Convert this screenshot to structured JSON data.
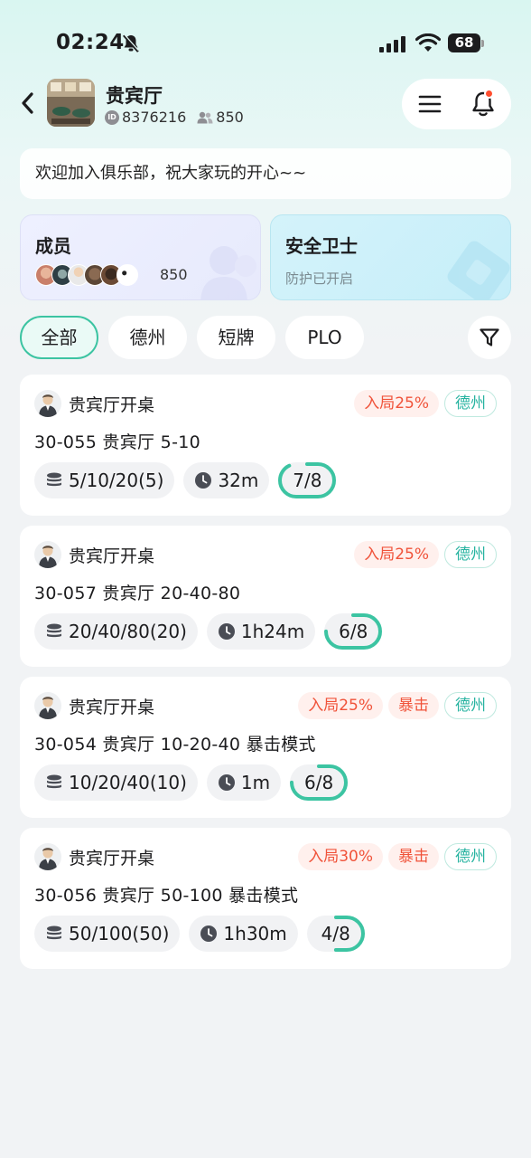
{
  "status_bar": {
    "time": "02:24",
    "battery": "68"
  },
  "header": {
    "club_name": "贵宾厅",
    "club_id": "8376216",
    "member_count": "850",
    "id_badge": "ID"
  },
  "welcome": "欢迎加入俱乐部，祝大家玩的开心~~",
  "members_card": {
    "title": "成员",
    "count": "850"
  },
  "security_card": {
    "title": "安全卫士",
    "status": "防护已开启"
  },
  "filters": [
    "全部",
    "德州",
    "短牌",
    "PLO"
  ],
  "active_filter": "全部",
  "colors": {
    "accent": "#3cc4a2",
    "tag_red": "#f0533a",
    "tag_green": "#26b3a0"
  },
  "tables": [
    {
      "host": "贵宾厅开桌",
      "tags": [
        "入局25%"
      ],
      "game": "德州",
      "title": "30-055 贵宾厅 5-10",
      "blinds": "5/10/20(5)",
      "duration": "32m",
      "seats": "7/8",
      "seated": 7,
      "max": 8
    },
    {
      "host": "贵宾厅开桌",
      "tags": [
        "入局25%"
      ],
      "game": "德州",
      "title": "30-057 贵宾厅 20-40-80",
      "blinds": "20/40/80(20)",
      "duration": "1h24m",
      "seats": "6/8",
      "seated": 6,
      "max": 8
    },
    {
      "host": "贵宾厅开桌",
      "tags": [
        "入局25%",
        "暴击"
      ],
      "game": "德州",
      "title": "30-054 贵宾厅 10-20-40 暴击模式",
      "blinds": "10/20/40(10)",
      "duration": "1m",
      "seats": "6/8",
      "seated": 6,
      "max": 8
    },
    {
      "host": "贵宾厅开桌",
      "tags": [
        "入局30%",
        "暴击"
      ],
      "game": "德州",
      "title": "30-056 贵宾厅 50-100 暴击模式",
      "blinds": "50/100(50)",
      "duration": "1h30m",
      "seats": "4/8",
      "seated": 4,
      "max": 8
    }
  ]
}
